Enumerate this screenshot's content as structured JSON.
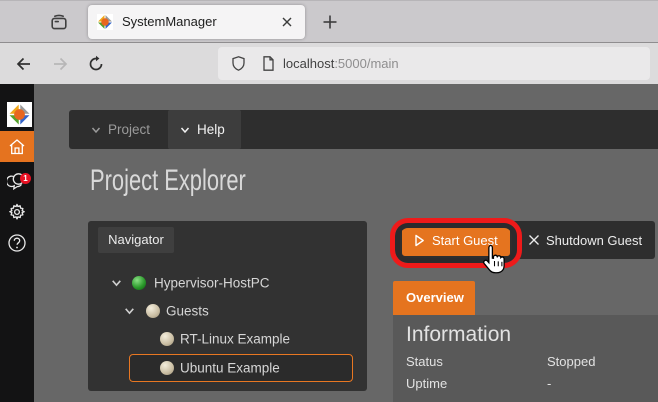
{
  "browser": {
    "tab_title": "SystemManager",
    "new_tab_label": "+",
    "url_host": "localhost",
    "url_rest": ":5000/main"
  },
  "app": {
    "menubar": {
      "project_label": "Project",
      "help_label": "Help"
    },
    "page_title": "Project Explorer",
    "sidebar": {
      "notification_count": "1"
    },
    "navigator": {
      "title": "Navigator",
      "tree": [
        {
          "label": "Hypervisor-HostPC",
          "level": 0,
          "expanded": true,
          "status_ball": "green",
          "selected": false
        },
        {
          "label": "Guests",
          "level": 1,
          "expanded": true,
          "status_ball": "beige",
          "selected": false
        },
        {
          "label": "RT-Linux Example",
          "level": 2,
          "expanded": false,
          "status_ball": "beige",
          "selected": false
        },
        {
          "label": "Ubuntu Example",
          "level": 2,
          "expanded": false,
          "status_ball": "beige",
          "selected": true
        }
      ]
    },
    "actions": {
      "start_label": "Start Guest",
      "shutdown_label": "Shutdown Guest"
    },
    "tabs": {
      "overview_label": "Overview"
    },
    "info": {
      "heading": "Information",
      "rows": [
        {
          "label": "Status",
          "value": "Stopped"
        },
        {
          "label": "Uptime",
          "value": "-"
        }
      ]
    }
  },
  "annotation": {
    "highlight_target": "start-guest-button",
    "color": "#ee1a1a"
  },
  "colors": {
    "accent_orange": "#e5741f",
    "selection_border": "#e87722",
    "page_background": "#676767",
    "panel_dark": "#323232",
    "info_panel": "#595959",
    "rail_background": "#131314",
    "badge_red": "#e81123"
  }
}
